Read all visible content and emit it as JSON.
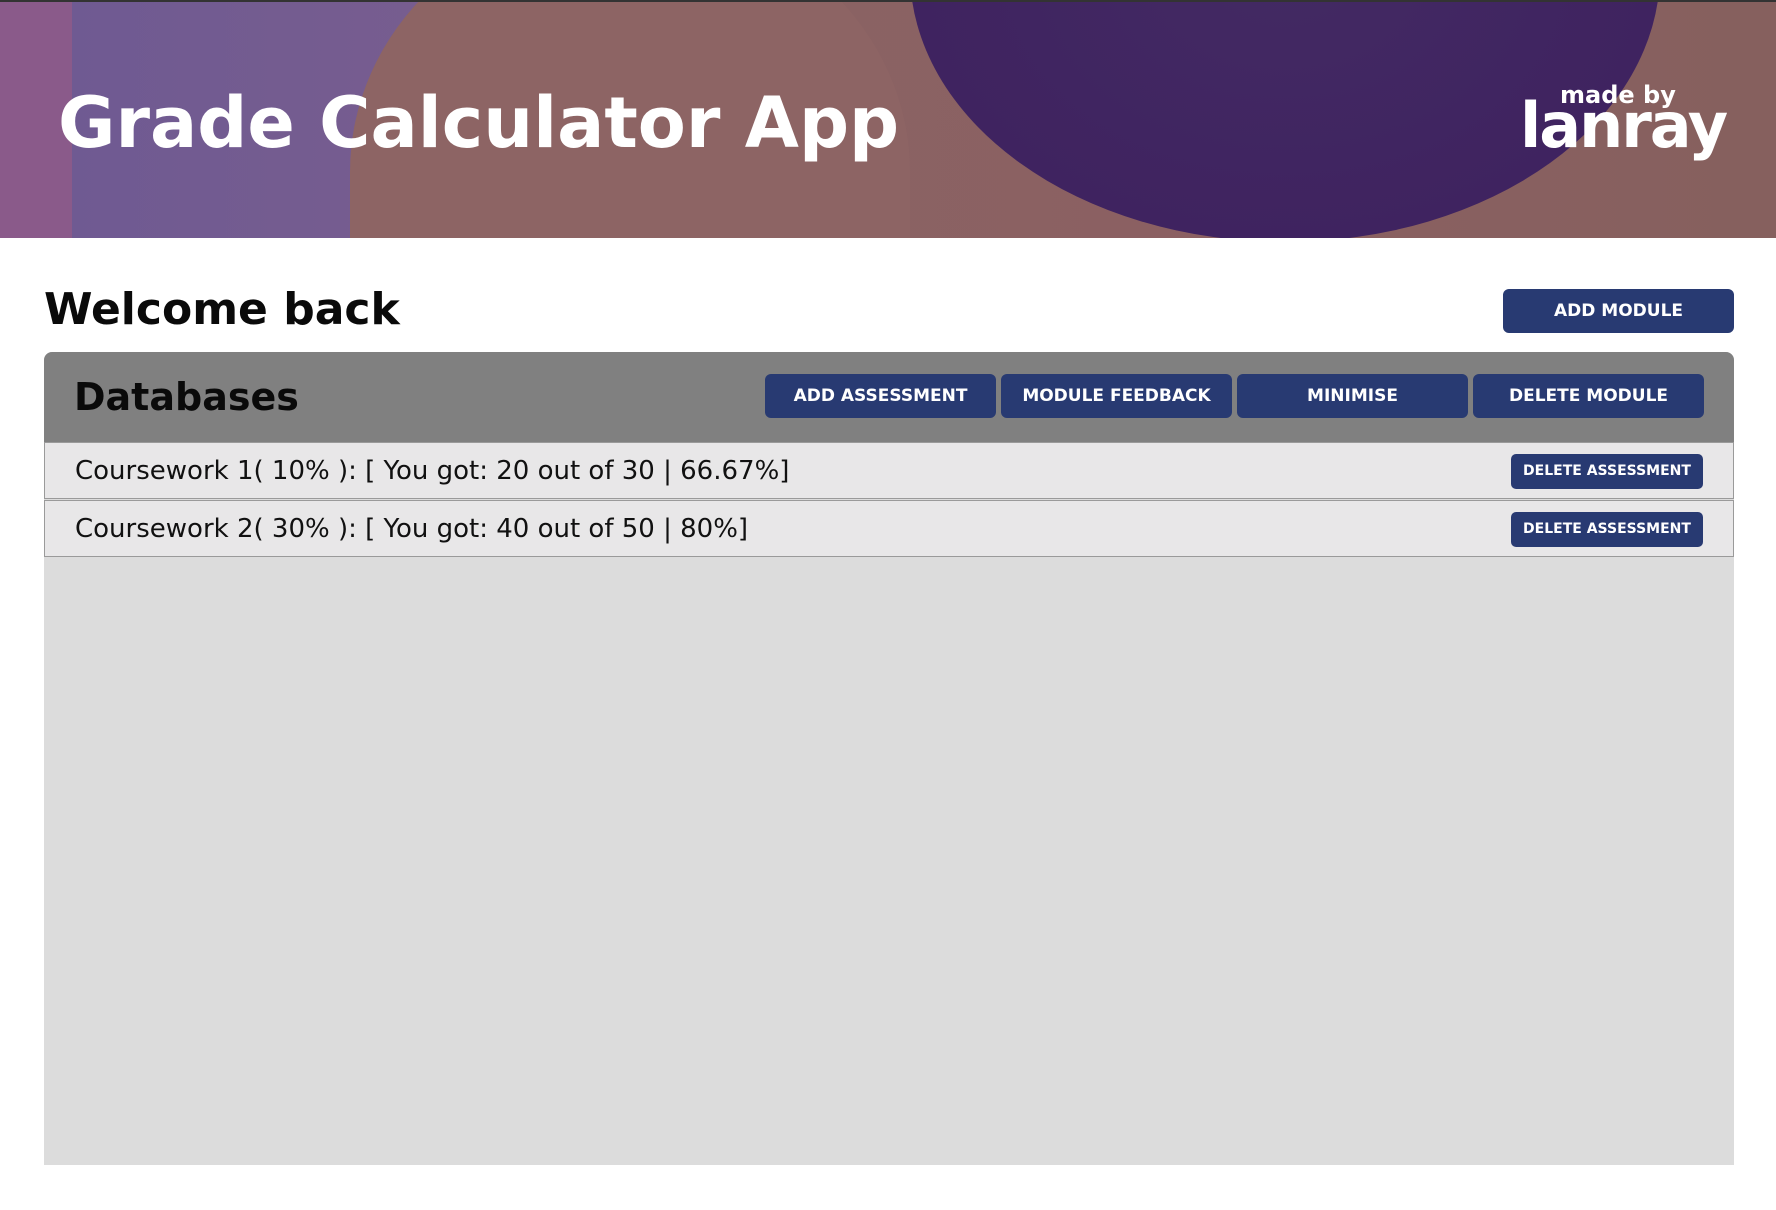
{
  "header": {
    "title": "Grade Calculator App",
    "logo_made_by": "made by",
    "logo_brand": "lanray"
  },
  "main": {
    "welcome": "Welcome back",
    "add_module_label": "ADD MODULE"
  },
  "module": {
    "name": "Databases",
    "buttons": {
      "add_assessment": "ADD ASSESSMENT",
      "module_feedback": "MODULE FEEDBACK",
      "minimise": "MINIMISE",
      "delete_module": "DELETE MODULE"
    },
    "assessments": [
      {
        "text": "Coursework 1( 10% ): [ You got: 20 out of 30 | 66.67%]",
        "delete_label": "DELETE ASSESSMENT"
      },
      {
        "text": "Coursework 2( 30% ): [ You got: 40 out of 50 | 80%]",
        "delete_label": "DELETE ASSESSMENT"
      }
    ]
  },
  "colors": {
    "button_bg": "#283a72",
    "button_text": "#ffffff",
    "module_header_bg": "#808080",
    "module_body_bg": "#dcdcdc",
    "assessment_row_bg": "#e8e7e8"
  }
}
